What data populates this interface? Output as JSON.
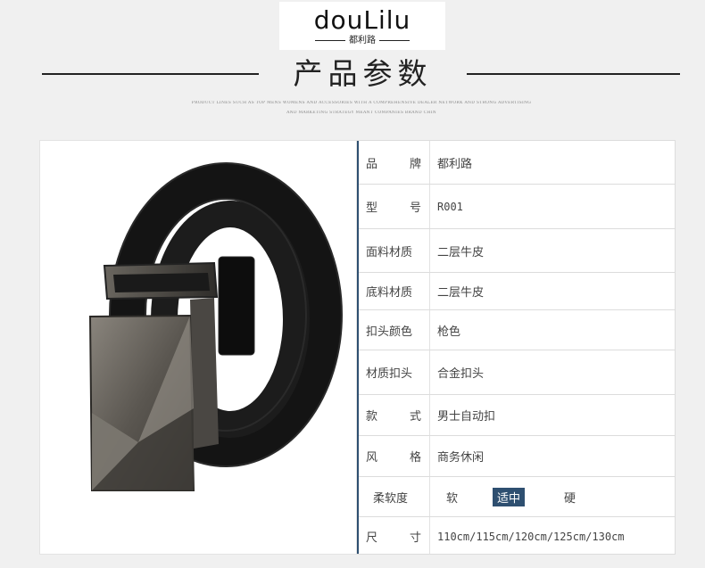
{
  "logo": {
    "name": "douLilu",
    "sub": "都利路"
  },
  "header": {
    "title": "产品参数",
    "tagline_1": "PRODUCT LINES SUCH AS TOP MENS WOMENS AND ACCESSORIES WITH A COMPREHENSIVE DEALER NETWORK AND STRONG ADVERTISING",
    "tagline_2": "AND MARKETING STRATEGY MEANT COMPANIES BRAND CHIN"
  },
  "specs": [
    {
      "label": "品　牌",
      "value": "都利路"
    },
    {
      "label": "型　号",
      "value": "R001"
    },
    {
      "label": "面料材质",
      "value": "二层牛皮"
    },
    {
      "label": "底料材质",
      "value": "二层牛皮"
    },
    {
      "label": "扣头颜色",
      "value": "枪色"
    },
    {
      "label": "材质扣头",
      "value": "合金扣头"
    },
    {
      "label": "款　式",
      "value": "男士自动扣"
    },
    {
      "label": "风　格",
      "value": "商务休闲"
    }
  ],
  "softness": {
    "label": "柔软度",
    "options": [
      "软",
      "适中",
      "硬"
    ],
    "selected": "适中"
  },
  "size": {
    "label": "尺　寸",
    "value": "110cm/115cm/120cm/125cm/130cm"
  }
}
